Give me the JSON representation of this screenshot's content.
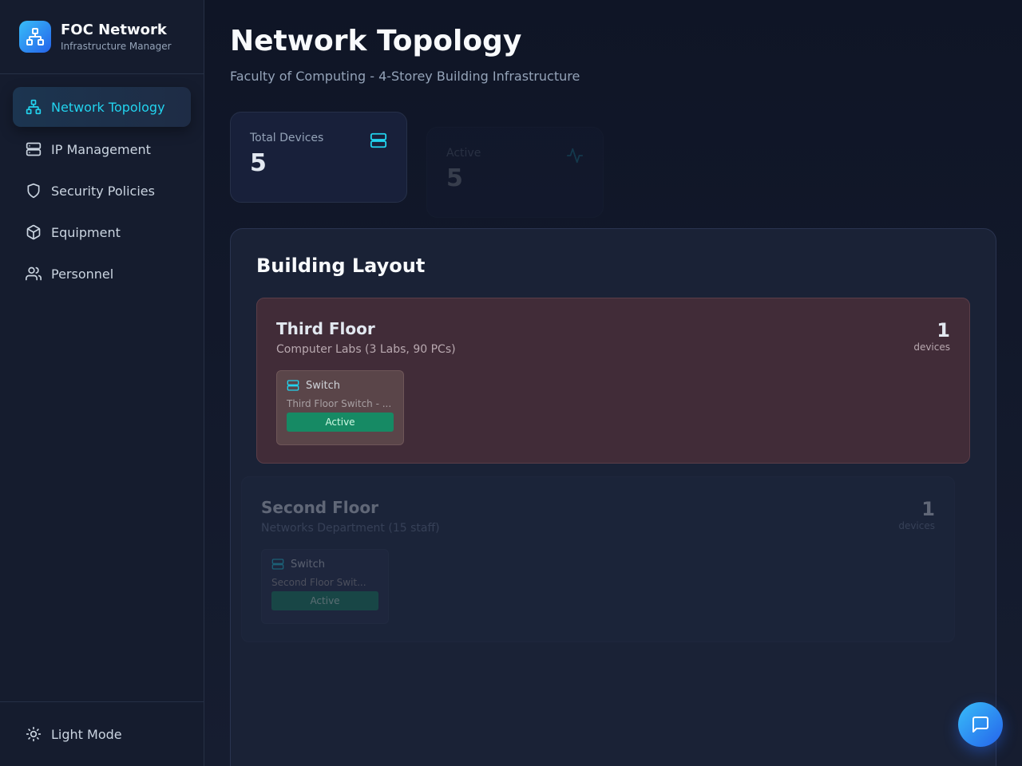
{
  "brand": {
    "title": "FOC Network",
    "subtitle": "Infrastructure Manager"
  },
  "sidebar": {
    "items": [
      {
        "label": "Network Topology",
        "icon": "network-icon",
        "active": true
      },
      {
        "label": "IP Management",
        "icon": "server-icon",
        "active": false
      },
      {
        "label": "Security Policies",
        "icon": "shield-icon",
        "active": false
      },
      {
        "label": "Equipment",
        "icon": "package-icon",
        "active": false
      },
      {
        "label": "Personnel",
        "icon": "users-icon",
        "active": false
      }
    ],
    "footer": {
      "label": "Light Mode",
      "icon": "sun-icon"
    }
  },
  "page": {
    "title": "Network Topology",
    "subtitle": "Faculty of Computing - 4-Storey Building Infrastructure"
  },
  "stats": [
    {
      "label": "Total Devices",
      "value": "5",
      "icon": "server-icon"
    },
    {
      "label": "Active",
      "value": "5",
      "icon": "activity-icon"
    }
  ],
  "layout": {
    "title": "Building Layout",
    "floors": [
      {
        "name": "Third Floor",
        "description": "Computer Labs (3 Labs, 90 PCs)",
        "count": "1",
        "count_unit": "devices",
        "devices": [
          {
            "type": "Switch",
            "name": "Third Floor Switch - ...",
            "status": "Active"
          }
        ]
      },
      {
        "name": "Second Floor",
        "description": "Networks Department (15 staff)",
        "count": "1",
        "count_unit": "devices",
        "devices": [
          {
            "type": "Switch",
            "name": "Second Floor Swit...",
            "status": "Active"
          }
        ]
      }
    ]
  },
  "colors": {
    "accent": "#22d3ee",
    "brand_gradient_start": "#38bdf8",
    "brand_gradient_end": "#2563eb",
    "status_active": "#168a64",
    "floor_highlight": "#412c38"
  }
}
